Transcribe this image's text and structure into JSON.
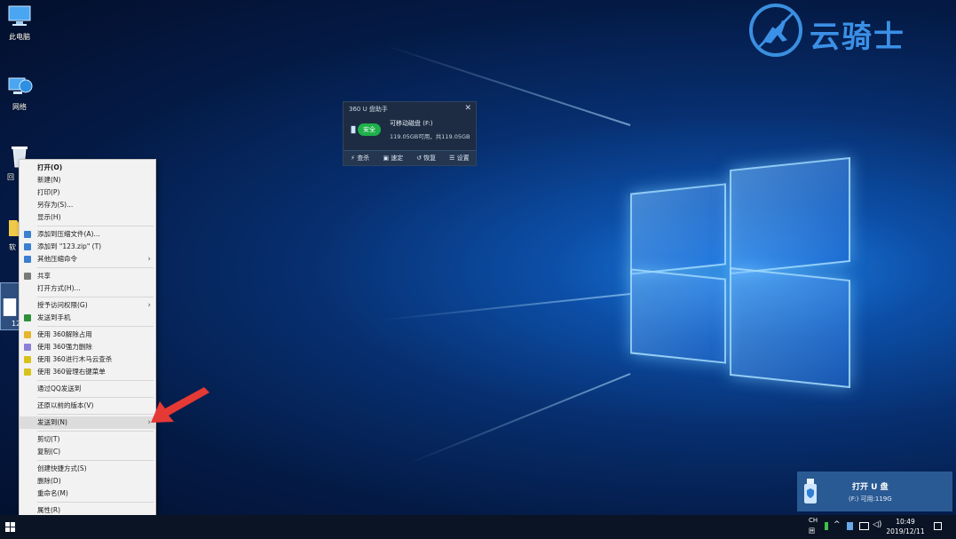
{
  "desktop": {
    "icons": [
      {
        "label": "此电脑",
        "icon": "computer-icon"
      },
      {
        "label": "网络",
        "icon": "network-icon"
      },
      {
        "label": "回",
        "icon": "recycle-bin-icon"
      },
      {
        "label": "软",
        "icon": "folder-icon"
      },
      {
        "label": "12",
        "icon": "file-icon"
      }
    ],
    "brand": "云骑士"
  },
  "u360": {
    "title": "360 U 盘助手",
    "close": "✕",
    "safe_badge": "安全",
    "drive_label": "可移动磁盘 (F:)",
    "capacity": "119.05GB可用，共119.05GB",
    "actions": [
      "查杀",
      "速定",
      "恢复",
      "设置"
    ]
  },
  "context_menu": {
    "items": [
      {
        "label": "打开(O)",
        "bold": true
      },
      {
        "label": "新建(N)"
      },
      {
        "label": "打印(P)"
      },
      {
        "label": "另存为(S)..."
      },
      {
        "label": "显示(H)"
      },
      {
        "sep": true
      },
      {
        "label": "添加到压缩文件(A)...",
        "icon_color": "#3a7fd0"
      },
      {
        "label": "添加到 \"123.zip\" (T)",
        "icon_color": "#3a7fd0"
      },
      {
        "label": "其他压缩命令",
        "icon_color": "#3a7fd0",
        "submenu": true
      },
      {
        "sep": true
      },
      {
        "label": "共享",
        "icon_color": "#7a7a7a"
      },
      {
        "label": "打开方式(H)..."
      },
      {
        "sep": true
      },
      {
        "label": "授予访问权限(G)",
        "submenu": true
      },
      {
        "label": "发送到手机",
        "icon_color": "#2f8f3a"
      },
      {
        "sep": true
      },
      {
        "label": "使用 360解除占用",
        "icon_color": "#e7b52b"
      },
      {
        "label": "使用 360强力删除",
        "icon_color": "#8a7fd6"
      },
      {
        "label": "使用 360进行木马云查杀",
        "icon_color": "#d8c21a"
      },
      {
        "label": "使用 360管理右键菜单",
        "icon_color": "#d8c21a"
      },
      {
        "sep": true
      },
      {
        "label": "通过QQ发送到"
      },
      {
        "sep": true
      },
      {
        "label": "还原以前的版本(V)"
      },
      {
        "sep": true
      },
      {
        "label": "发送到(N)",
        "submenu": true,
        "highlight": true
      },
      {
        "sep": true
      },
      {
        "label": "剪切(T)"
      },
      {
        "label": "复制(C)"
      },
      {
        "sep": true
      },
      {
        "label": "创建快捷方式(S)"
      },
      {
        "label": "删除(D)"
      },
      {
        "label": "重命名(M)"
      },
      {
        "sep": true
      },
      {
        "label": "属性(R)"
      }
    ]
  },
  "usb_panel": {
    "title": "打开 U 盘",
    "subtitle": "(F:)  可用:119G"
  },
  "taskbar": {
    "ime_top": "CH",
    "ime_bottom": "囲",
    "time": "10:49",
    "date": "2019/12/11"
  },
  "colors": {
    "accent": "#3b90e6",
    "arrow": "#e53935"
  }
}
